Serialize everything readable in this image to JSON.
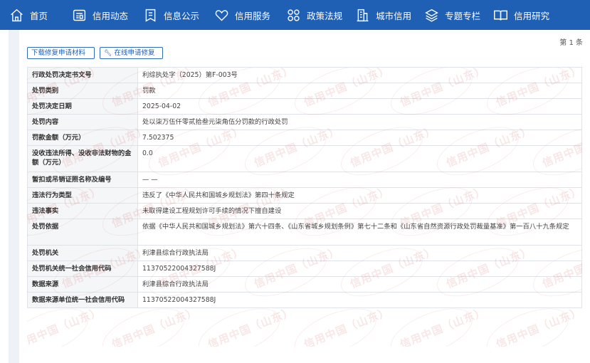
{
  "nav": {
    "items": [
      {
        "label": "首页",
        "icon": "home-icon"
      },
      {
        "label": "信用动态",
        "icon": "news-card-icon"
      },
      {
        "label": "信息公示",
        "icon": "document-icon"
      },
      {
        "label": "信用服务",
        "icon": "heart-icon"
      },
      {
        "label": "政策法规",
        "icon": "grid-icon"
      },
      {
        "label": "城市信用",
        "icon": "building-icon"
      },
      {
        "label": "专题专栏",
        "icon": "layers-icon"
      },
      {
        "label": "信用研究",
        "icon": "book-icon"
      }
    ]
  },
  "page_count": "第 1 条",
  "buttons": {
    "download": "下载修复申请材料",
    "repair": "在线申请修复"
  },
  "record": {
    "rows": [
      {
        "key": "行政处罚决定书文号",
        "value": "利综执处字（2025）第F-003号"
      },
      {
        "key": "处罚类别",
        "value": "罚款"
      },
      {
        "key": "处罚决定日期",
        "value": "2025-04-02"
      },
      {
        "key": "处罚内容",
        "value": "处以柒万伍仟零贰拾叁元柒角伍分罚款的行政处罚"
      },
      {
        "key": "罚款金额（万元）",
        "value": "7.502375"
      },
      {
        "key": "没收违法所得、没收非法财物的金额（万元）",
        "value": "0.0"
      },
      {
        "key": "暂扣或吊销证照名称及编号",
        "value": "— —"
      },
      {
        "key": "违法行为类型",
        "value": "违反了《中华人民共和国城乡规划法》第四十条规定"
      },
      {
        "key": "违法事实",
        "value": "未取得建设工程规划许可手续的情况下擅自建设"
      },
      {
        "key": "处罚依据",
        "value": "依据《中华人民共和国城乡规划法》第六十四条、《山东省城乡规划条例》第七十二条和《山东省自然资源行政处罚裁量基准》第一百八十九条规定"
      },
      {
        "key": "处罚机关",
        "value": "利津县综合行政执法局"
      },
      {
        "key": "处罚机关统一社会信用代码",
        "value": "11370522004327588J"
      },
      {
        "key": "数据来源",
        "value": "利津县综合行政执法局"
      },
      {
        "key": "数据来源单位统一社会信用代码",
        "value": "11370522004327588J"
      }
    ]
  },
  "watermark": {
    "text": "信用中国（山东）"
  },
  "colors": {
    "nav_bg": "#1f5fb4",
    "button_border": "#2f6db8"
  }
}
